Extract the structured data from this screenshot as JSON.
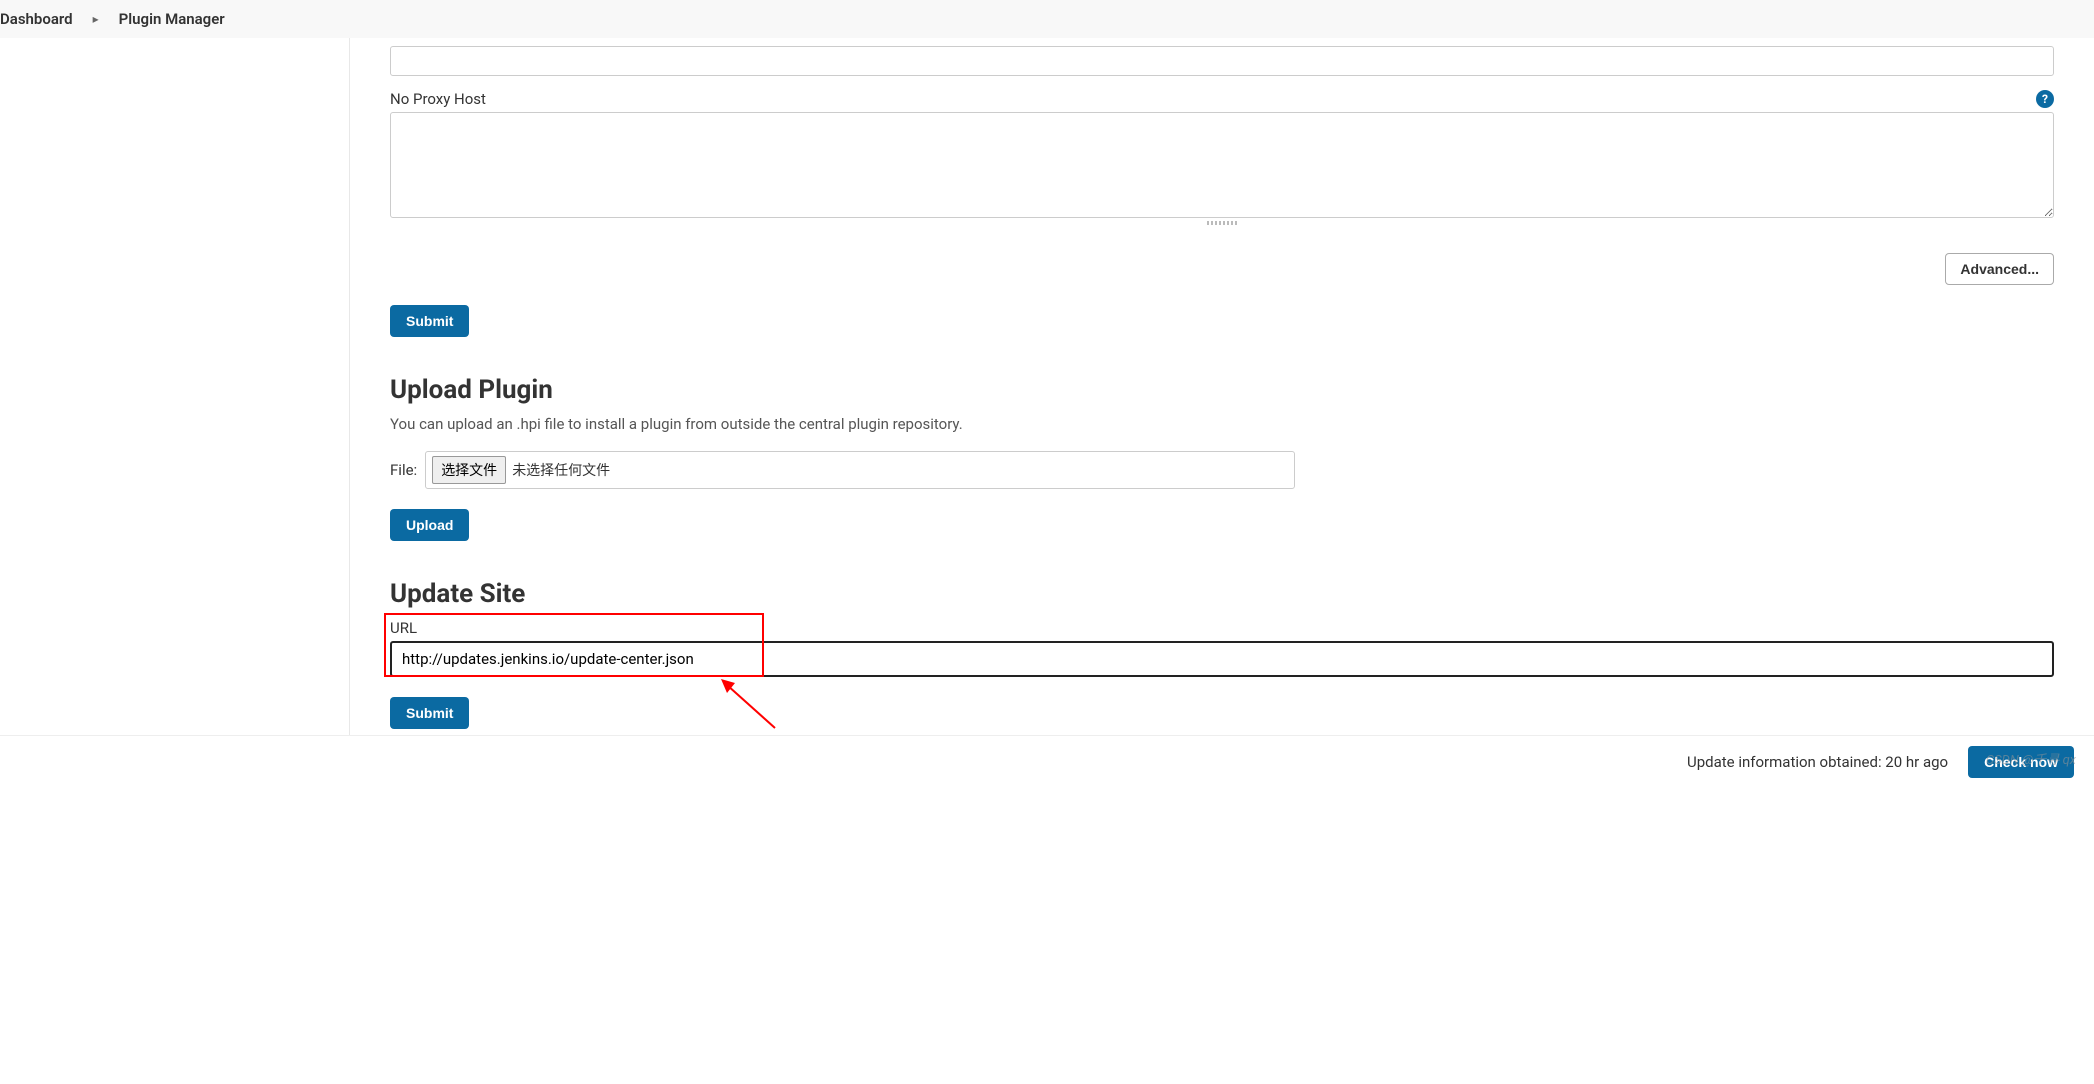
{
  "breadcrumbs": {
    "dashboard": "Dashboard",
    "plugin_manager": "Plugin Manager"
  },
  "proxy": {
    "no_proxy_host_label": "No Proxy Host",
    "advanced_btn": "Advanced...",
    "submit_btn": "Submit"
  },
  "upload": {
    "heading": "Upload Plugin",
    "desc": "You can upload an .hpi file to install a plugin from outside the central plugin repository.",
    "file_label": "File:",
    "choose_btn": "选择文件",
    "no_file_text": "未选择任何文件",
    "upload_btn": "Upload"
  },
  "update_site": {
    "heading": "Update Site",
    "url_label": "URL",
    "url_value": "http://updates.jenkins.io/update-center.json",
    "submit_btn": "Submit"
  },
  "footer": {
    "info_text": "Update information obtained: 20 hr ago",
    "check_now_btn": "Check now"
  },
  "watermark": "CSDN @千寻 qx"
}
